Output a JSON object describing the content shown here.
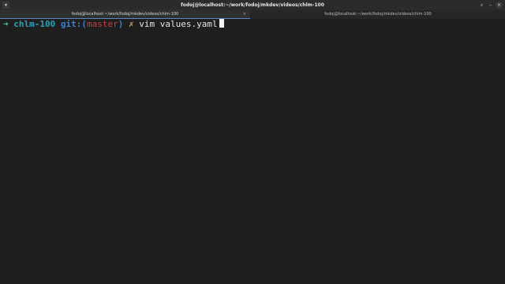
{
  "window": {
    "title": "fodoj@localhost:~/work/fodoj/mkdev/videos/chlm-100"
  },
  "titlebar_icons": {
    "menu": "menu-icon",
    "search": "search-icon",
    "minimize": "minimize-icon",
    "close": "close-icon"
  },
  "tabs": [
    {
      "label": "fodoj@localhost:~/work/fodoj/mkdev/videos/chlm-100",
      "active": true,
      "close": "×"
    },
    {
      "label": "fodoj@localhost:~/work/fodoj/mkdev/videos/chlm-100",
      "active": false
    }
  ],
  "terminal": {
    "prompt_arrow": "➜",
    "directory": "chlm-100",
    "git_prefix": "git:(",
    "branch": "master",
    "git_suffix": ")",
    "dirty_marker": "✗",
    "command": "vim values.yaml"
  },
  "colors": {
    "background": "#1e1e1e",
    "arrow": "#4fc3a1",
    "directory": "#2aa1b3",
    "git": "#3a7fd0",
    "branch": "#d03b3b",
    "dirty": "#c7a84a",
    "tab_accent": "#5a86c7"
  }
}
